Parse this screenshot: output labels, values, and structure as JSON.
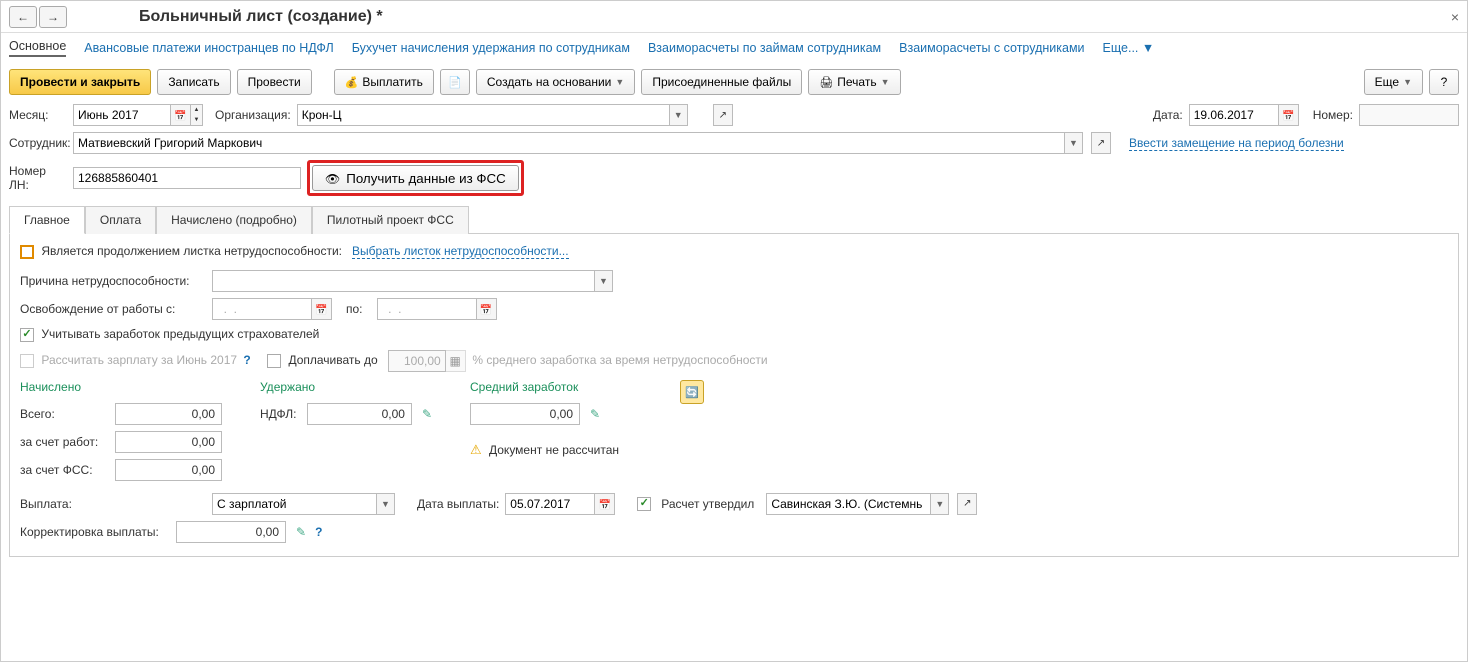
{
  "title": "Больничный лист (создание) *",
  "nav": {
    "back": "←",
    "fwd": "→",
    "close": "×"
  },
  "navlinks": {
    "main": "Основное",
    "l1": "Авансовые платежи иностранцев по НДФЛ",
    "l2": "Бухучет начисления удержания по сотрудникам",
    "l3": "Взаиморасчеты по займам сотрудникам",
    "l4": "Взаиморасчеты с сотрудниками",
    "more": "Еще..."
  },
  "toolbar": {
    "post_close": "Провести и закрыть",
    "write": "Записать",
    "post": "Провести",
    "pay": "Выплатить",
    "create_based": "Создать на основании",
    "attached": "Присоединенные файлы",
    "print": "Печать",
    "more": "Еще",
    "help": "?"
  },
  "header": {
    "month_lbl": "Месяц:",
    "month": "Июнь 2017",
    "org_lbl": "Организация:",
    "org": "Крон-Ц",
    "date_lbl": "Дата:",
    "date": "19.06.2017",
    "num_lbl": "Номер:",
    "num": "",
    "emp_lbl": "Сотрудник:",
    "emp": "Матвиевский Григорий Маркович",
    "subst_link": "Ввести замещение на период болезни",
    "ln_lbl": "Номер ЛН:",
    "ln": "126885860401",
    "fss_btn": "Получить данные из ФСС"
  },
  "tabs": {
    "t1": "Главное",
    "t2": "Оплата",
    "t3": "Начислено (подробно)",
    "t4": "Пилотный проект ФСС"
  },
  "main": {
    "cont_lbl": "Является продолжением листка нетрудоспособности:",
    "cont_link": "Выбрать листок нетрудоспособности...",
    "reason_lbl": "Причина нетрудоспособности:",
    "reason": "",
    "release_lbl": "Освобождение от работы с:",
    "date_ph": "  .  .    ",
    "to_lbl": "по:",
    "prev_ins": "Учитывать заработок предыдущих страхователей",
    "calc_salary": "Рассчитать зарплату за Июнь 2017",
    "topup_lbl": "Доплачивать до",
    "topup_val": "100,00",
    "topup_suffix": "% среднего заработка за время нетрудоспособности",
    "accrued_h": "Начислено",
    "withheld_h": "Удержано",
    "avg_h": "Средний заработок",
    "total_lbl": "Всего:",
    "total": "0,00",
    "employer_lbl": "за счет работ:",
    "employer": "0,00",
    "fss_lbl": "за счет ФСС:",
    "fss": "0,00",
    "ndfl_lbl": "НДФЛ:",
    "ndfl": "0,00",
    "avg": "0,00",
    "not_calc": "Документ не рассчитан",
    "payout_lbl": "Выплата:",
    "payout": "С зарплатой",
    "payout_date_lbl": "Дата выплаты:",
    "payout_date": "05.07.2017",
    "approved_lbl": "Расчет утвердил",
    "approver": "Савинская З.Ю. (Системнь",
    "corr_lbl": "Корректировка выплаты:",
    "corr": "0,00"
  }
}
